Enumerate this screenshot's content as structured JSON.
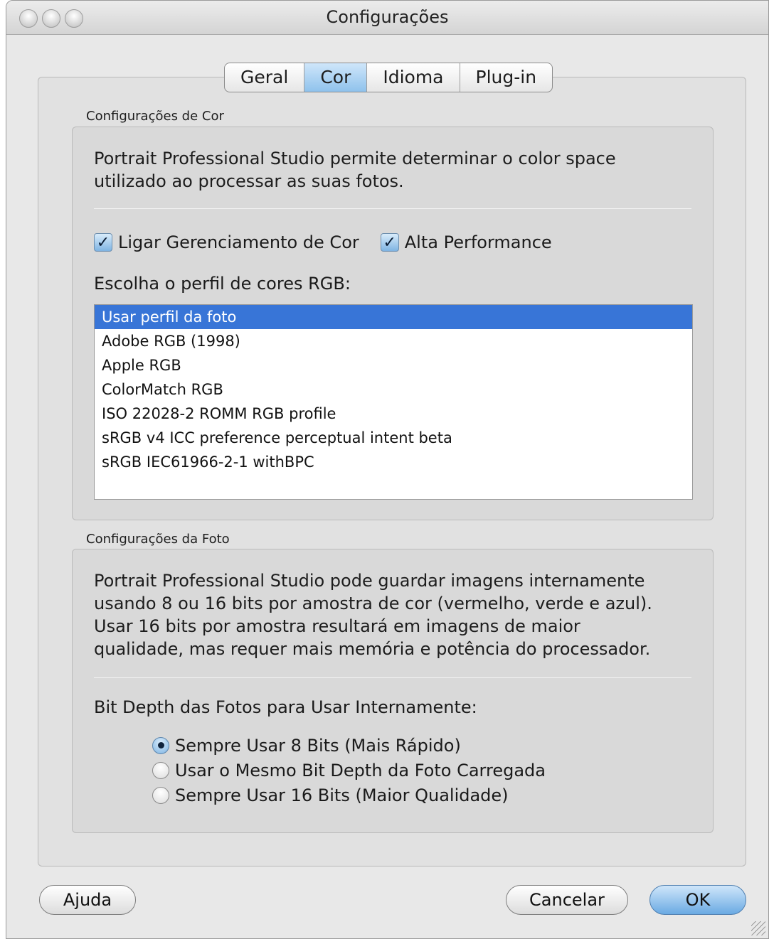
{
  "window": {
    "title": "Configurações"
  },
  "tabs": [
    {
      "label": "Geral",
      "active": false
    },
    {
      "label": "Cor",
      "active": true
    },
    {
      "label": "Idioma",
      "active": false
    },
    {
      "label": "Plug-in",
      "active": false
    }
  ],
  "color_settings": {
    "group_label": "Configurações de Cor",
    "description_line1": "Portrait Professional Studio permite determinar o color space",
    "description_line2": "utilizado ao processar as suas fotos.",
    "color_management": {
      "label": "Ligar Gerenciamento de Cor",
      "checked": true
    },
    "high_performance": {
      "label": "Alta Performance",
      "checked": true
    },
    "profile_prompt": "Escolha o perfil de cores RGB:",
    "profiles": [
      "Usar perfil da foto",
      "Adobe RGB (1998)",
      "Apple RGB",
      "ColorMatch RGB",
      "ISO 22028-2 ROMM RGB profile",
      "sRGB v4 ICC preference perceptual intent beta",
      "sRGB IEC61966-2-1 withBPC"
    ],
    "selected_profile": "Usar perfil da foto"
  },
  "photo_settings": {
    "group_label": "Configurações da Foto",
    "description_line1": "Portrait Professional Studio pode guardar imagens  internamente",
    "description_line2": "usando  8 ou 16 bits por amostra de cor (vermelho, verde e azul).",
    "description_line3": "Usar 16 bits por amostra resultará em imagens de maior",
    "description_line4": "qualidade, mas requer mais memória e potência do processador.",
    "bit_depth_prompt": "Bit Depth das Fotos para Usar Internamente:",
    "options": [
      {
        "label": "Sempre Usar 8 Bits (Mais Rápido)",
        "selected": true
      },
      {
        "label": "Usar o Mesmo Bit Depth da Foto Carregada",
        "selected": false
      },
      {
        "label": "Sempre Usar 16 Bits (Maior Qualidade)",
        "selected": false
      }
    ]
  },
  "buttons": {
    "help": "Ajuda",
    "cancel": "Cancelar",
    "ok": "OK"
  },
  "colors": {
    "accent": "#3875d7",
    "tab_active": "#8fc2ec",
    "window_bg": "#e8e8e8"
  }
}
